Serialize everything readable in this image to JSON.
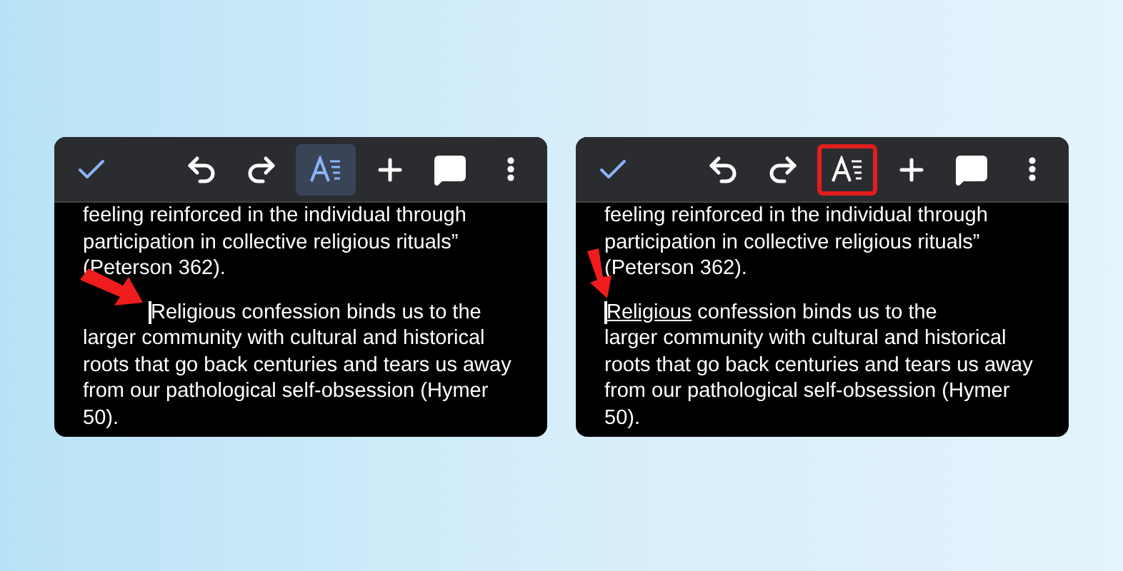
{
  "panels": [
    {
      "toolbar": [
        {
          "kind": "check"
        },
        {
          "kind": "undo"
        },
        {
          "kind": "redo"
        },
        {
          "kind": "format",
          "selected": true,
          "marked": false
        },
        {
          "kind": "add"
        },
        {
          "kind": "comment"
        },
        {
          "kind": "more"
        }
      ],
      "paragraphs": [
        {
          "lines": [
            "feeling reinforced in the individual through",
            "participation in collective religious rituals”",
            "(Peterson 362)."
          ],
          "indent": false,
          "first_word_underlined": false,
          "cursor": false
        },
        {
          "lines": [
            "Religious confession binds us to the",
            "larger community with cultural and historical",
            "roots that go back centuries and tears us away",
            "from our pathological self-obsession (Hymer",
            "50)."
          ],
          "indent": true,
          "first_word_underlined": false,
          "cursor": true
        }
      ],
      "arrow": {
        "kind": "diagonal"
      }
    },
    {
      "toolbar": [
        {
          "kind": "check"
        },
        {
          "kind": "undo"
        },
        {
          "kind": "redo"
        },
        {
          "kind": "format",
          "selected": false,
          "marked": true
        },
        {
          "kind": "add"
        },
        {
          "kind": "comment"
        },
        {
          "kind": "more"
        }
      ],
      "paragraphs": [
        {
          "lines": [
            "feeling reinforced in the individual through",
            "participation in collective religious rituals”",
            "(Peterson 362)."
          ],
          "indent": false,
          "first_word_underlined": false,
          "cursor": false
        },
        {
          "lines": [
            "Religious confession binds us to the",
            "larger community with cultural and historical",
            "roots that go back centuries and tears us away",
            "from our pathological self-obsession (Hymer",
            "50)."
          ],
          "indent": false,
          "first_word_underlined": true,
          "cursor": true
        }
      ],
      "arrow": {
        "kind": "down"
      }
    }
  ]
}
